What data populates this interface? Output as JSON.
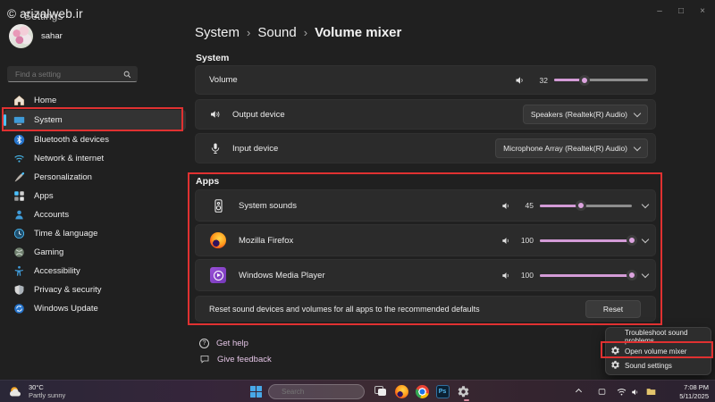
{
  "watermark": "© arizalweb.ir",
  "window": {
    "title": "Settings",
    "controls": {
      "minimize": "–",
      "maximize": "□",
      "close": "×"
    }
  },
  "sidebar": {
    "user": {
      "name": "sahar"
    },
    "search_placeholder": "Find a setting",
    "items": [
      {
        "label": "Home"
      },
      {
        "label": "System",
        "selected": true
      },
      {
        "label": "Bluetooth & devices"
      },
      {
        "label": "Network & internet"
      },
      {
        "label": "Personalization"
      },
      {
        "label": "Apps"
      },
      {
        "label": "Accounts"
      },
      {
        "label": "Time & language"
      },
      {
        "label": "Gaming"
      },
      {
        "label": "Accessibility"
      },
      {
        "label": "Privacy & security"
      },
      {
        "label": "Windows Update"
      }
    ]
  },
  "breadcrumb": {
    "parts": [
      "System",
      "Sound",
      "Volume mixer"
    ],
    "separator": "›"
  },
  "system_section": {
    "label": "System",
    "volume": {
      "label": "Volume",
      "value": 32
    },
    "output_device": {
      "label": "Output device",
      "value": "Speakers (Realtek(R) Audio)"
    },
    "input_device": {
      "label": "Input device",
      "value": "Microphone Array (Realtek(R) Audio)"
    }
  },
  "apps_section": {
    "label": "Apps",
    "apps": [
      {
        "name": "System sounds",
        "volume": 45
      },
      {
        "name": "Mozilla Firefox",
        "volume": 100
      },
      {
        "name": "Windows Media Player",
        "volume": 100
      }
    ],
    "reset_row": {
      "text": "Reset sound devices and volumes for all apps to the recommended defaults",
      "button_label": "Reset"
    }
  },
  "footer_links": [
    {
      "label": "Get help"
    },
    {
      "label": "Give feedback"
    }
  ],
  "context_menu": {
    "items": [
      {
        "label": "Troubleshoot sound problems"
      },
      {
        "label": "Open volume mixer",
        "highlighted": true
      },
      {
        "label": "Sound settings"
      }
    ]
  },
  "taskbar": {
    "weather": {
      "temperature": "30°C",
      "condition": "Partly sunny"
    },
    "search_placeholder": "Search",
    "photoshop_label": "Ps",
    "clock": {
      "time": "7:08 PM",
      "date": "5/11/2025"
    }
  },
  "icons": {
    "help_glyph": "?"
  },
  "colors": {
    "accent_slider": "#d39bd6",
    "annotation_red": "#e03131",
    "link": "#e2c3e4"
  }
}
